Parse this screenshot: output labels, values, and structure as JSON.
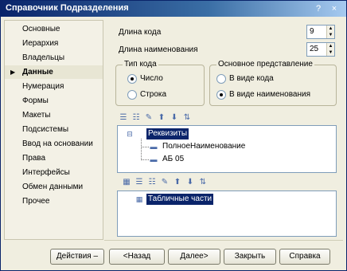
{
  "window": {
    "title": "Справочник Подразделения",
    "help_label": "?",
    "close_label": "×"
  },
  "sidebar": {
    "items": [
      {
        "label": "Основные"
      },
      {
        "label": "Иерархия"
      },
      {
        "label": "Владельцы"
      },
      {
        "label": "Данные",
        "active": true
      },
      {
        "label": "Нумерация"
      },
      {
        "label": "Формы"
      },
      {
        "label": "Макеты"
      },
      {
        "label": "Подсистемы"
      },
      {
        "label": "Ввод на основании"
      },
      {
        "label": "Права"
      },
      {
        "label": "Интерфейсы"
      },
      {
        "label": "Обмен данными"
      },
      {
        "label": "Прочее"
      }
    ]
  },
  "fields": {
    "code_length": {
      "label": "Длина кода",
      "value": "9"
    },
    "name_length": {
      "label": "Длина наименования",
      "value": "25"
    }
  },
  "code_type": {
    "title": "Тип кода",
    "options": [
      {
        "label": "Число",
        "selected": true
      },
      {
        "label": "Строка",
        "selected": false
      }
    ]
  },
  "main_view": {
    "title": "Основное представление",
    "options": [
      {
        "label": "В виде кода",
        "selected": false
      },
      {
        "label": "В виде наименования",
        "selected": true
      }
    ]
  },
  "requisites": {
    "root": "Реквизиты",
    "children": [
      "ПолноеНаименование",
      "АБ 05"
    ]
  },
  "tabular": {
    "root": "Табличные части"
  },
  "buttons": {
    "actions": "Действия",
    "back": "<Назад",
    "next": "Далее>",
    "close": "Закрыть",
    "help": "Справка"
  },
  "colors": {
    "title_bar": "#0a246a",
    "selection": "#0a246a",
    "panel": "#f0eee0"
  }
}
